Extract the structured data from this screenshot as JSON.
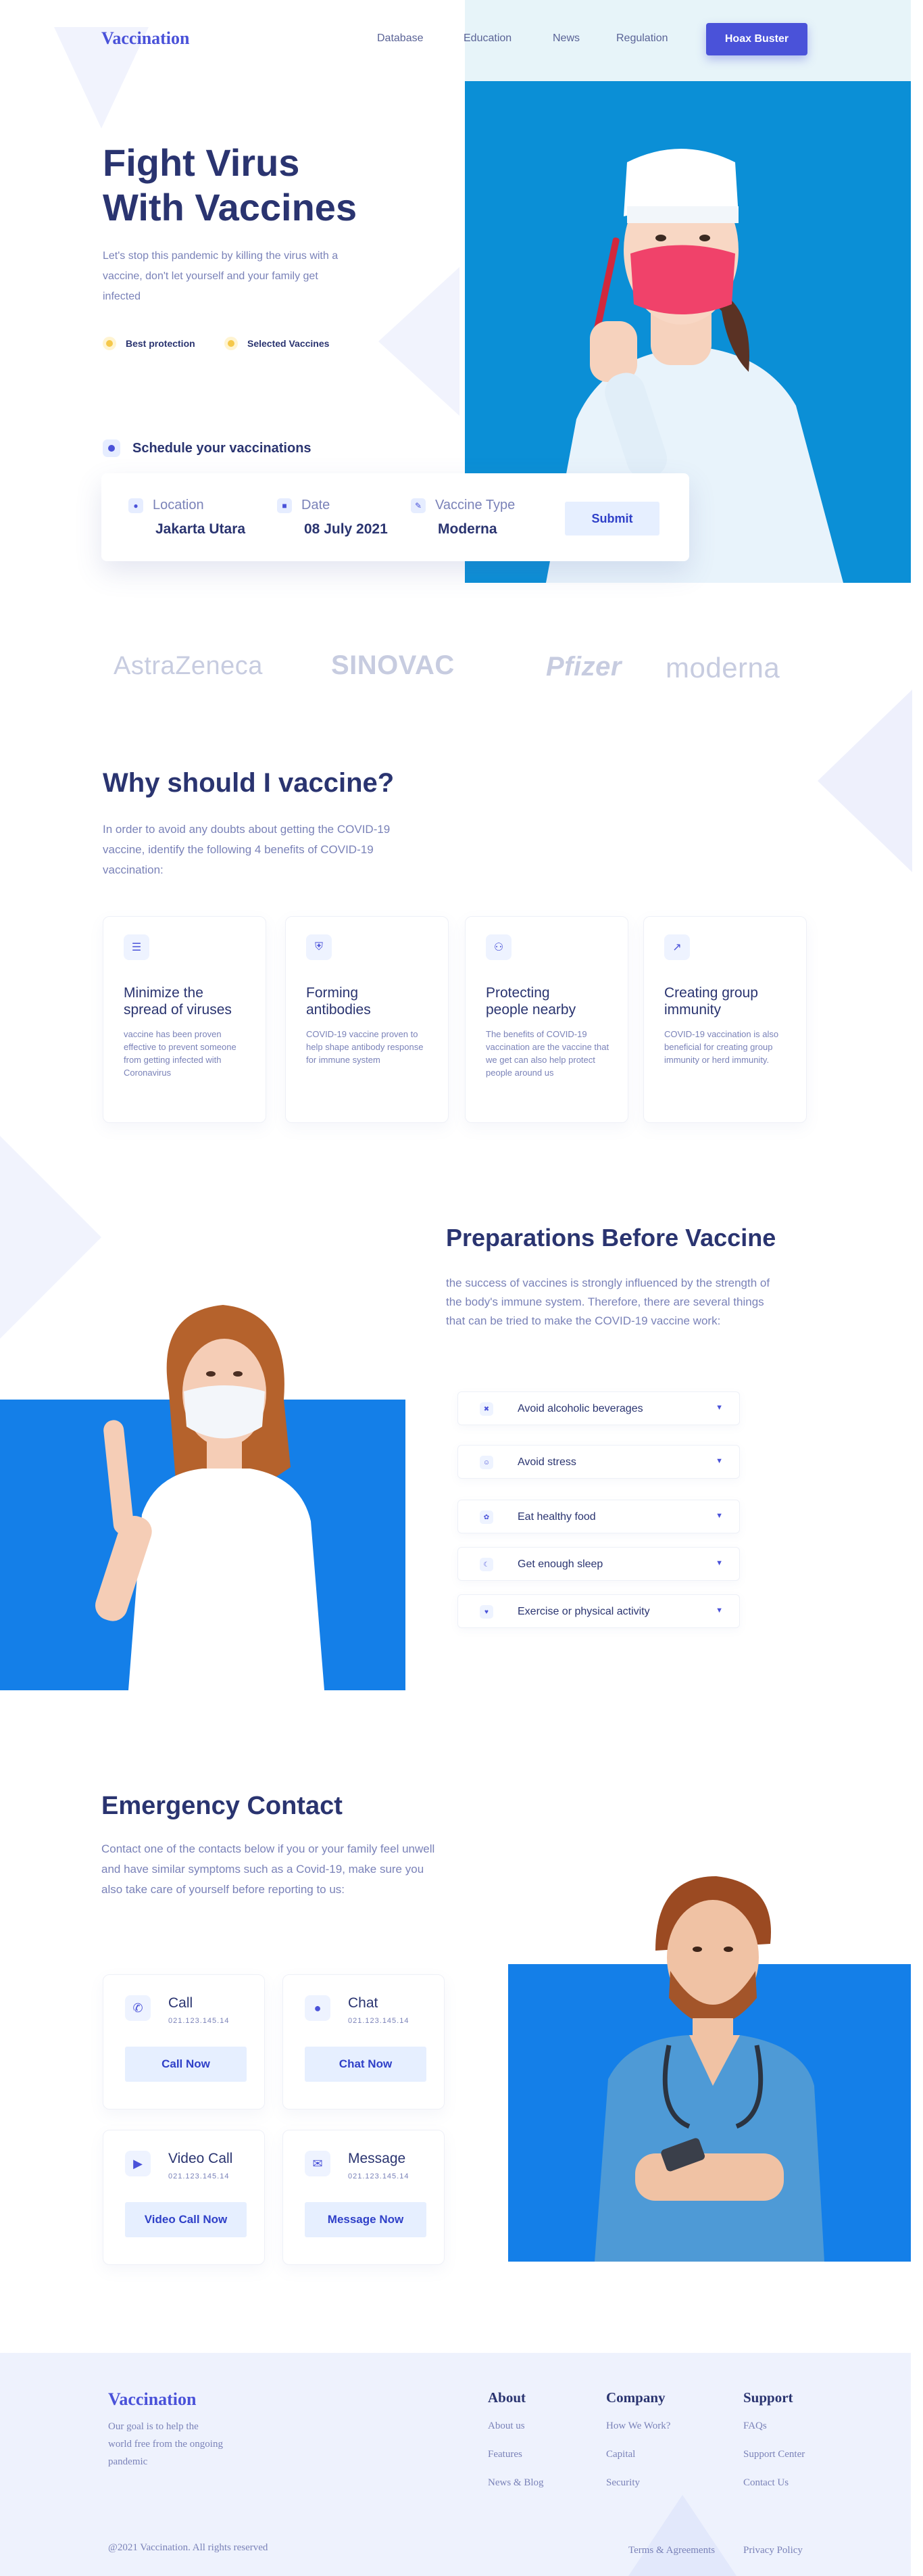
{
  "brand": "Vaccination",
  "nav": {
    "links": [
      "Database",
      "Education",
      "News",
      "Regulation"
    ],
    "cta": "Hoax Buster"
  },
  "hero": {
    "title_line1": "Fight Virus",
    "title_line2": "With Vaccines",
    "subtitle": "Let's stop this pandemic by killing the virus with a vaccine, don't let yourself and your family get infected",
    "badges": [
      "Best protection",
      "Selected Vaccines"
    ],
    "schedule_label": "Schedule your vaccinations",
    "form": {
      "location_label": "Location",
      "location_value": "Jakarta Utara",
      "date_label": "Date",
      "date_value": "08 July 2021",
      "vaccine_label": "Vaccine Type",
      "vaccine_value": "Moderna",
      "submit": "Submit"
    }
  },
  "logos": [
    "AstraZeneca",
    "SINOVAC",
    "Pfizer",
    "moderna"
  ],
  "why": {
    "title": "Why should I vaccine?",
    "intro": "In order to avoid any doubts about getting the COVID-19 vaccine, identify the following 4 benefits of COVID-19 vaccination:",
    "cards": [
      {
        "title": "Minimize the spread of viruses",
        "text": "vaccine has been proven effective to prevent someone from getting infected with Coronavirus",
        "icon": "sliders-icon"
      },
      {
        "title": "Forming antibodies",
        "text": "COVID-19 vaccine proven to help shape antibody response for immune system",
        "icon": "shield-icon"
      },
      {
        "title": "Protecting people nearby",
        "text": "The benefits of COVID-19 vaccination are the vaccine that we get can also help protect people around us",
        "icon": "group-icon"
      },
      {
        "title": "Creating group immunity",
        "text": "COVID-19 vaccination is also beneficial for creating group immunity or herd immunity.",
        "icon": "chart-icon"
      }
    ]
  },
  "prep": {
    "title": "Preparations Before Vaccine",
    "intro": "the success of vaccines is strongly influenced by the strength of the body's immune system. Therefore, there are several things that can be tried to make the COVID-19 vaccine work:",
    "items": [
      "Avoid alcoholic beverages",
      "Avoid stress",
      "Eat healthy food",
      "Get enough sleep",
      "Exercise or physical activity"
    ]
  },
  "emergency": {
    "title": "Emergency Contact",
    "intro": "Contact one of the contacts below if you or your family feel unwell and have similar symptoms such as a Covid-19, make sure you also take care of yourself before reporting to us:",
    "contacts": [
      {
        "title": "Call",
        "number": "021.123.145.14",
        "button": "Call Now",
        "icon": "phone-icon"
      },
      {
        "title": "Chat",
        "number": "021.123.145.14",
        "button": "Chat Now",
        "icon": "chat-icon"
      },
      {
        "title": "Video Call",
        "number": "021.123.145.14",
        "button": "Video Call Now",
        "icon": "video-icon"
      },
      {
        "title": "Message",
        "number": "021.123.145.14",
        "button": "Message Now",
        "icon": "mail-icon"
      }
    ]
  },
  "footer": {
    "brand": "Vaccination",
    "tagline": "Our goal is to help the world free from the ongoing pandemic",
    "columns": [
      {
        "title": "About",
        "links": [
          "About us",
          "Features",
          "News & Blog"
        ]
      },
      {
        "title": "Company",
        "links": [
          "How We Work?",
          "Capital",
          "Security"
        ]
      },
      {
        "title": "Support",
        "links": [
          "FAQs",
          "Support Center",
          "Contact Us"
        ]
      }
    ],
    "copyright": "@2021 Vaccination. All rights reserved",
    "bottom_links": [
      "Terms & Agreements",
      "Privacy Policy"
    ]
  },
  "colors": {
    "accent": "#4a52d9",
    "navy": "#2a3470",
    "hero_blue": "#0b8fd6",
    "section_blue": "#147fe8",
    "footer_bg": "#eef2fd"
  }
}
